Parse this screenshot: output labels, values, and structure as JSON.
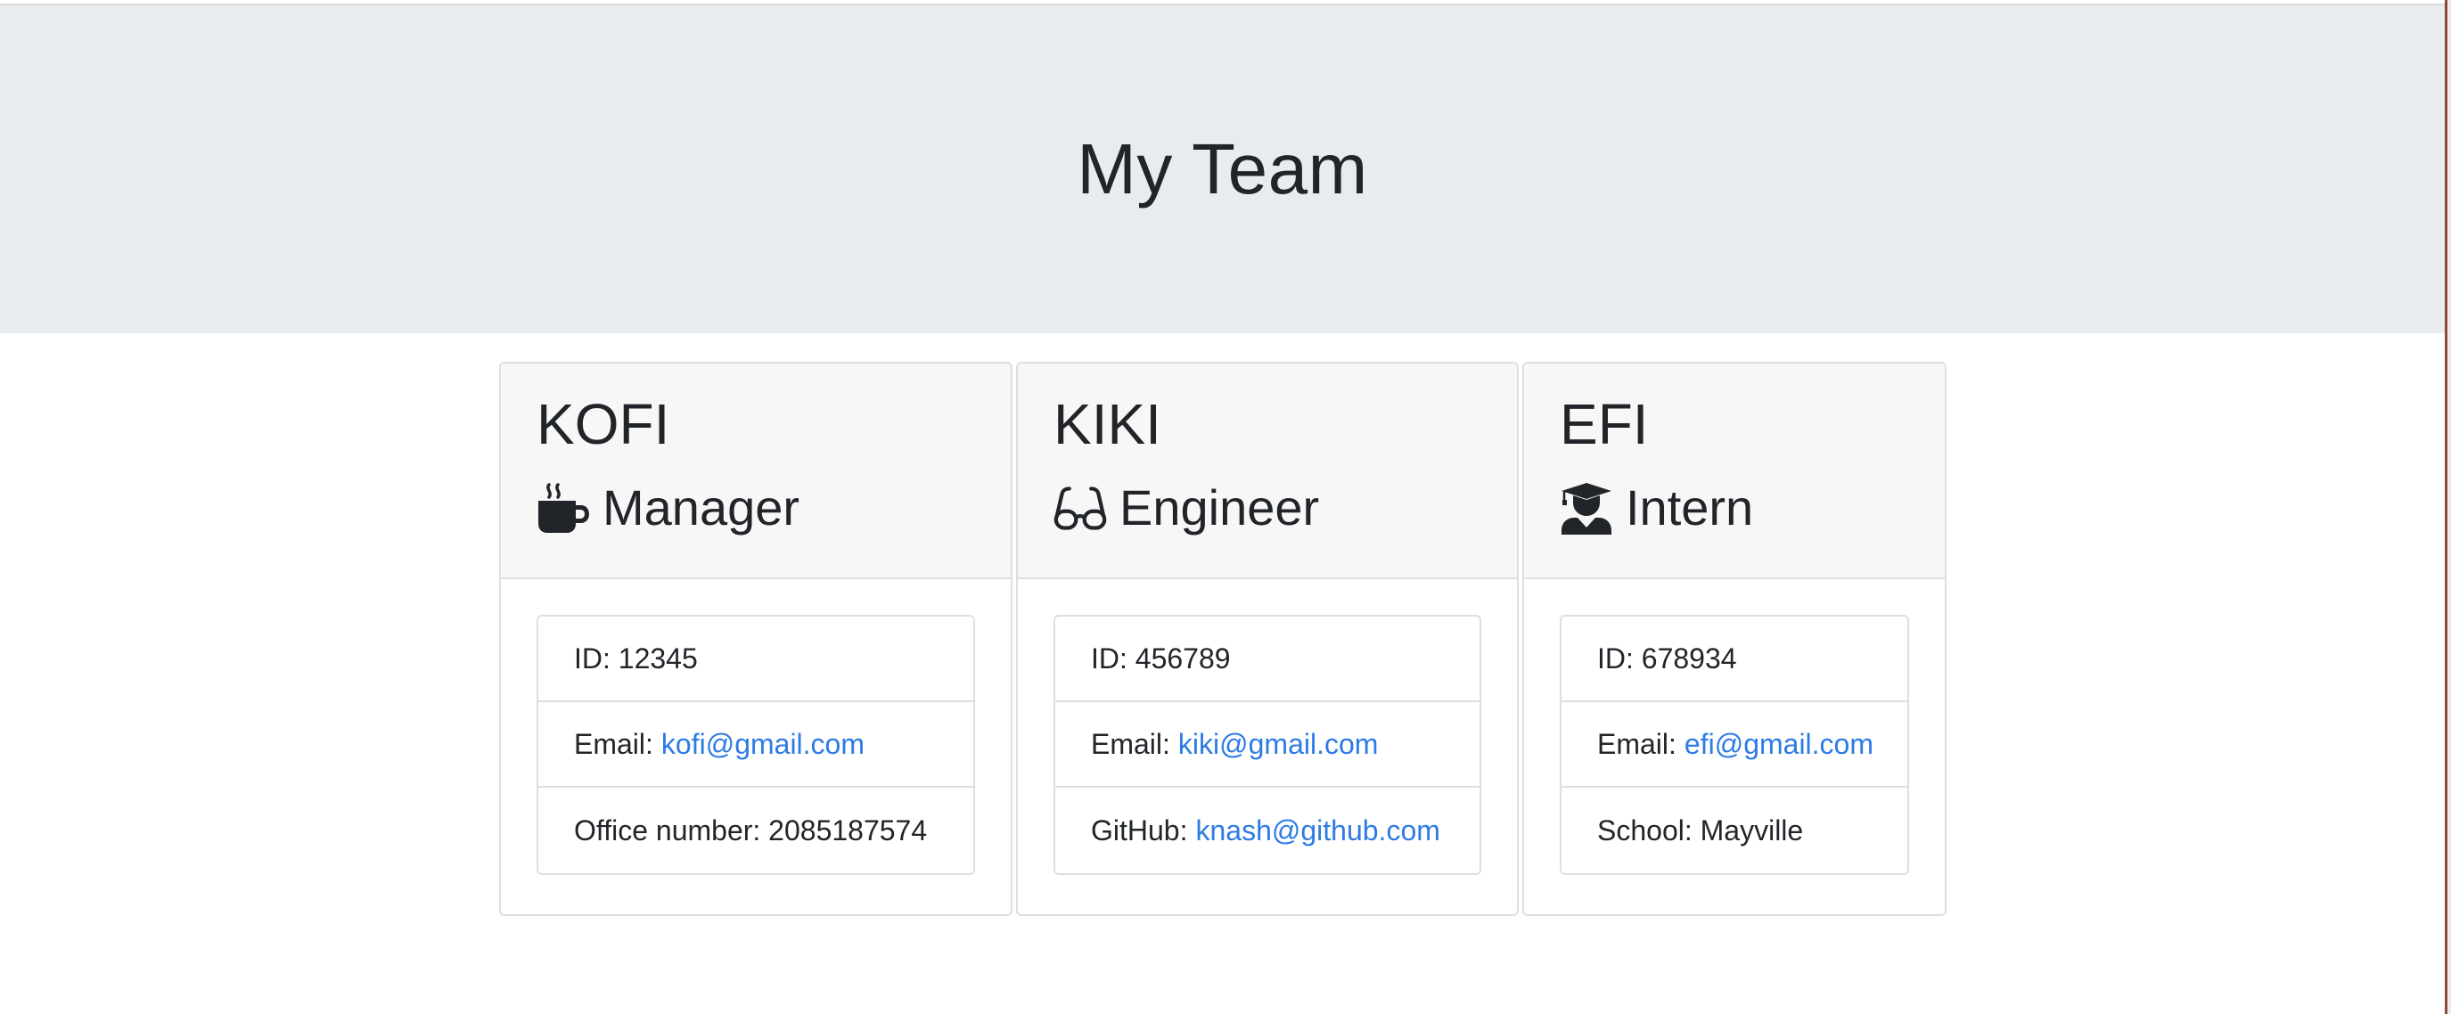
{
  "header": {
    "title": "My Team",
    "background": "#e9ecef"
  },
  "link_color": "#2d7be5",
  "cards": [
    {
      "name": "KOFI",
      "role": "Manager",
      "role_icon": "mug-hot-icon",
      "id_text": "ID: 12345",
      "email_label": "Email:",
      "email": "kofi@gmail.com",
      "extra_label": "Office number: 2085187574",
      "extra_link": ""
    },
    {
      "name": "KIKI",
      "role": "Engineer",
      "role_icon": "glasses-icon",
      "id_text": "ID: 456789",
      "email_label": "Email:",
      "email": "kiki@gmail.com",
      "extra_label": "GitHub:",
      "extra_link": "knash@github.com"
    },
    {
      "name": "EFI",
      "role": "Intern",
      "role_icon": "user-graduate-icon",
      "id_text": "ID: 678934",
      "email_label": "Email:",
      "email": "efi@gmail.com",
      "extra_label": "School: Mayville",
      "extra_link": ""
    }
  ]
}
